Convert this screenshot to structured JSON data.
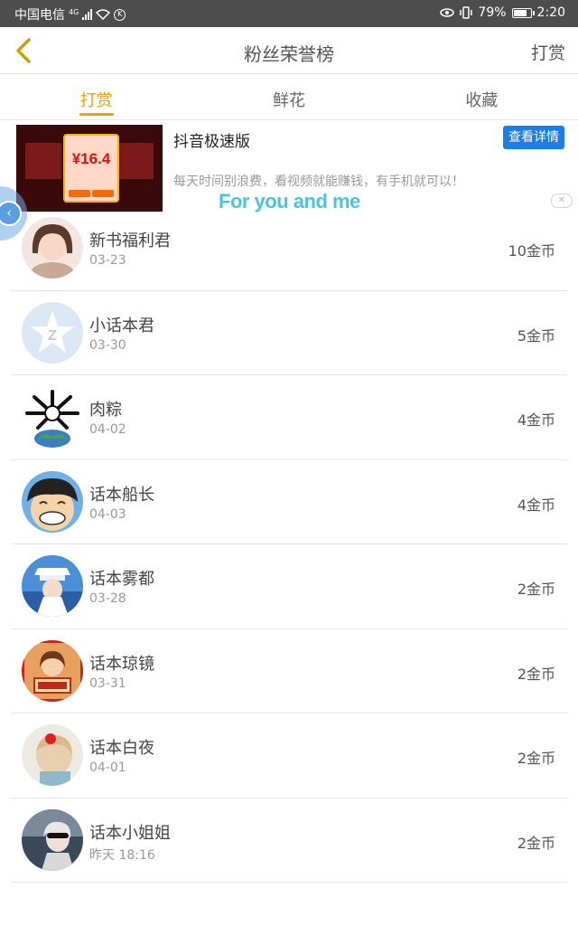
{
  "status_bar": {
    "carrier": "中国电信",
    "network": "4G",
    "battery": "79%",
    "time": "2:20"
  },
  "header": {
    "title": "粉丝荣誉榜",
    "right_link": "打赏"
  },
  "tabs": [
    {
      "label": "打赏",
      "active": true
    },
    {
      "label": "鲜花",
      "active": false
    },
    {
      "label": "收藏",
      "active": false
    }
  ],
  "ad": {
    "title": "抖音极速版",
    "button": "查看详情",
    "description": "每天时间别浪费，看视频就能赚钱，有手机就可以！",
    "image_amount": "¥16.4"
  },
  "overlay_text": "For you and me",
  "supporters": [
    {
      "name": "新书福利君",
      "date": "03-23",
      "coins": "10金币"
    },
    {
      "name": "小话本君",
      "date": "03-30",
      "coins": "5金币"
    },
    {
      "name": "肉粽",
      "date": "04-02",
      "coins": "4金币"
    },
    {
      "name": "话本船长",
      "date": "04-03",
      "coins": "4金币"
    },
    {
      "name": "话本雾都",
      "date": "03-28",
      "coins": "2金币"
    },
    {
      "name": "话本琼镜",
      "date": "03-31",
      "coins": "2金币"
    },
    {
      "name": "话本白夜",
      "date": "04-01",
      "coins": "2金币"
    },
    {
      "name": "话本小姐姐",
      "date": "昨天 18:16",
      "coins": "2金币"
    }
  ],
  "colors": {
    "accent": "#f0a000",
    "ad_button": "#1a7ee8",
    "status_bar": "#4d4d4d"
  }
}
